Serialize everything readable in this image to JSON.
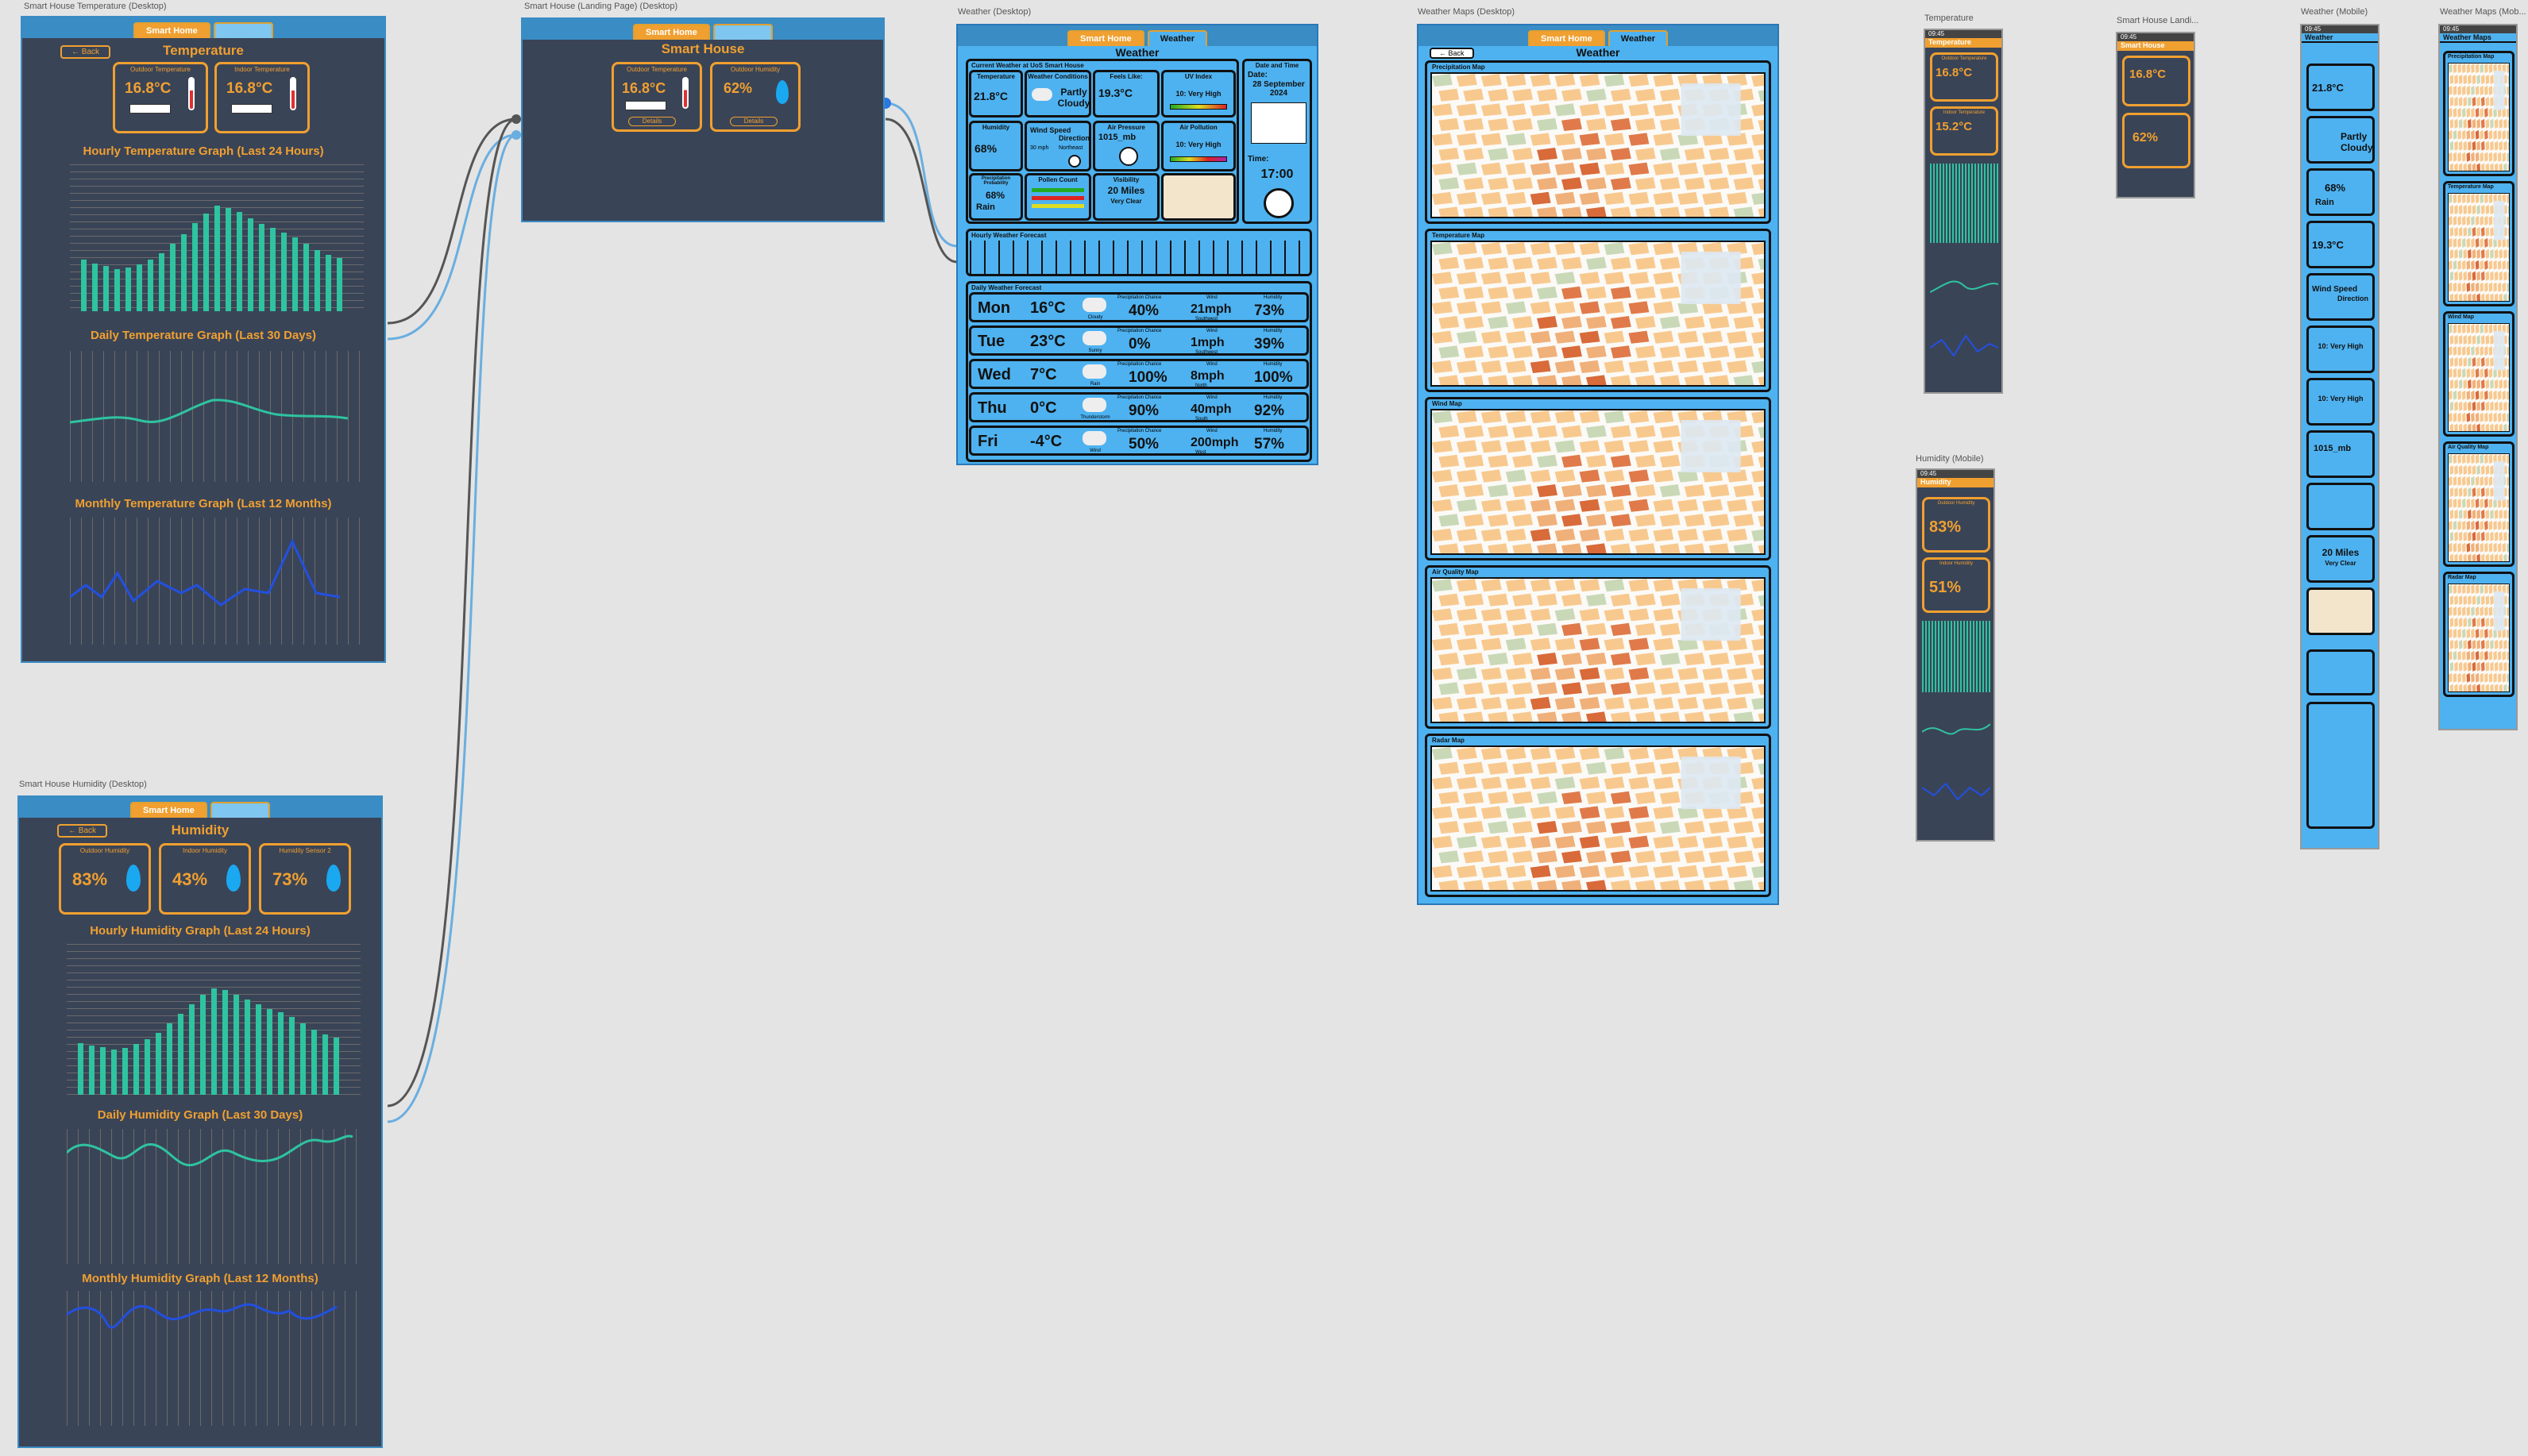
{
  "frames": {
    "temp_desktop": "Smart House Temperature (Desktop)",
    "landing_desktop": "Smart House (Landing Page) (Desktop)",
    "weather_desktop": "Weather (Desktop)",
    "maps_desktop": "Weather Maps (Desktop)",
    "temp_mobile": "Temperature",
    "landing_mobile": "Smart House Landi...",
    "weather_mobile": "Weather (Mobile)",
    "maps_mobile": "Weather Maps (Mob...",
    "humidity_desktop": "Smart House Humidity (Desktop)",
    "humidity_mobile": "Humidity (Mobile)"
  },
  "tabs": {
    "home": "Smart Home",
    "weather": "Weather"
  },
  "back": "← Back",
  "temperature": {
    "title": "Temperature",
    "outdoor_label": "Outdoor Temperature",
    "outdoor_value": "16.8°C",
    "indoor_label": "Indoor Temperature",
    "indoor_value": "16.8°C",
    "hourly_title": "Hourly Temperature Graph (Last 24 Hours)",
    "daily_title": "Daily Temperature Graph (Last 30 Days)",
    "monthly_title": "Monthly Temperature Graph (Last 12 Months)"
  },
  "landing": {
    "title": "Smart House",
    "temp_label": "Outdoor Temperature",
    "temp_value": "16.8°C",
    "hum_label": "Outdoor Humidity",
    "hum_value": "62%",
    "details": "Details"
  },
  "humidity": {
    "title": "Humidity",
    "outdoor_label": "Outdoor Humidity",
    "outdoor_value": "83%",
    "indoor_label": "Indoor Humidity",
    "indoor_value": "43%",
    "sensor_label": "Humidity Sensor 2",
    "sensor_value": "73%",
    "hourly_title": "Hourly Humidity Graph (Last 24 Hours)",
    "daily_title": "Daily Humidity Graph (Last 30 Days)",
    "monthly_title": "Monthly Humidity Graph (Last 12 Months)"
  },
  "weather": {
    "title": "Weather",
    "current_label": "Current Weather at UoS Smart House",
    "date_label": "Date and Time",
    "date_title": "Date:",
    "date_value": "28 September 2024",
    "time_title": "Time:",
    "time_value": "17:00",
    "temp_t": "Temperature",
    "temp_v": "21.8°C",
    "cond_t": "Weather Conditions",
    "cond_v": "Partly Cloudy",
    "feels_t": "Feels Like:",
    "feels_v": "19.3°C",
    "uv_t": "UV Index",
    "uv_v": "10: Very High",
    "hum_t": "Humidity",
    "hum_v": "68%",
    "wind_t": "Wind Speed",
    "wind_dir": "Direction",
    "wind_v": "30 mph",
    "wind_d": "Northeast",
    "press_t": "Air Pressure",
    "press_v": "1015_mb",
    "poll_t": "Air Pollution",
    "poll_v": "10: Very High",
    "precip_t": "Precipitation Probability",
    "precip_v": "68%",
    "precip_r": "Rain",
    "pollen_t": "Pollen Count",
    "vis_t": "Visibility",
    "vis_v": "20 Miles",
    "vis_s": "Very Clear",
    "hourly_label": "Hourly Weather Forecast",
    "daily_label": "Daily Weather Forecast",
    "chance_label": "Precipitation Chance",
    "wind_label": "Wind",
    "hum_label": "Humidity",
    "days": [
      {
        "day": "Mon",
        "temp": "16°C",
        "cond": "Cloudy",
        "precip": "40%",
        "wind": "21mph",
        "dir": "Southwest",
        "hum": "73%"
      },
      {
        "day": "Tue",
        "temp": "23°C",
        "cond": "Sunny",
        "precip": "0%",
        "wind": "1mph",
        "dir": "Southwest",
        "hum": "39%"
      },
      {
        "day": "Wed",
        "temp": "7°C",
        "cond": "Rain",
        "precip": "100%",
        "wind": "8mph",
        "dir": "North",
        "hum": "100%"
      },
      {
        "day": "Thu",
        "temp": "0°C",
        "cond": "Thunderstorm",
        "precip": "90%",
        "wind": "40mph",
        "dir": "South",
        "hum": "92%"
      },
      {
        "day": "Fri",
        "temp": "-4°C",
        "cond": "Wind",
        "precip": "50%",
        "wind": "200mph",
        "dir": "West",
        "hum": "57%"
      }
    ]
  },
  "maps": {
    "title": "Weather",
    "precip": "Precipitation Map",
    "temp": "Temperature Map",
    "wind": "Wind Map",
    "air": "Air Quality Map",
    "radar": "Radar Map",
    "mobile_title": "Weather Maps"
  },
  "mobile": {
    "time": "09:45",
    "temp_title": "Temperature",
    "outdoor_label": "Outdoor Temperature",
    "outdoor_value": "16.8°C",
    "indoor_label": "Indoor Temperature",
    "indoor_value": "15.2°C",
    "landing_title": "Smart House",
    "landing_temp": "16.8°C",
    "landing_hum": "62%",
    "hum_title": "Humidity",
    "hum_out_label": "Outdoor Humidity",
    "hum_out": "83%",
    "hum_in_label": "Indoor Humidity",
    "hum_in": "51%",
    "weather_title": "Weather",
    "w_temp": "21.8°C",
    "w_cond": "Partly Cloudy",
    "w_precip": "68%",
    "w_rain": "Rain",
    "w_feels": "19.3°C",
    "w_wind": "Wind Speed",
    "w_dir": "Direction",
    "w_uv": "10: Very High",
    "w_poll": "10: Very High",
    "w_press": "1015_mb",
    "w_vis": "20 Miles",
    "w_vis_s": "Very Clear"
  }
}
